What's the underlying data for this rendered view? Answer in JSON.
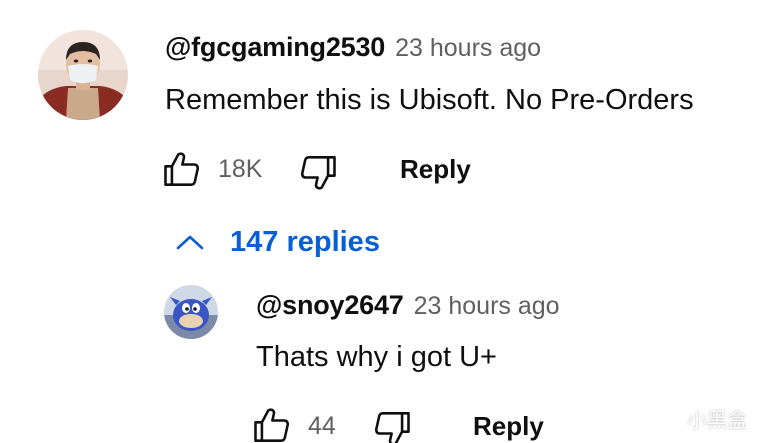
{
  "comment": {
    "author": "@fgcgaming2530",
    "time": "23 hours ago",
    "text": "Remember this is Ubisoft. No Pre-Orders",
    "likes": "18K",
    "reply_label": "Reply",
    "avatar_icon": "user-photo-masked"
  },
  "replies_toggle": {
    "label": "147 replies",
    "icon": "chevron-up-icon",
    "color": "#065fd4"
  },
  "reply": {
    "author": "@snoy2647",
    "time": "23 hours ago",
    "text": "Thats why i got U+",
    "likes": "44",
    "reply_label": "Reply",
    "avatar_icon": "ugandan-knuckles-avatar"
  },
  "watermark": {
    "text": "小黑盒"
  }
}
